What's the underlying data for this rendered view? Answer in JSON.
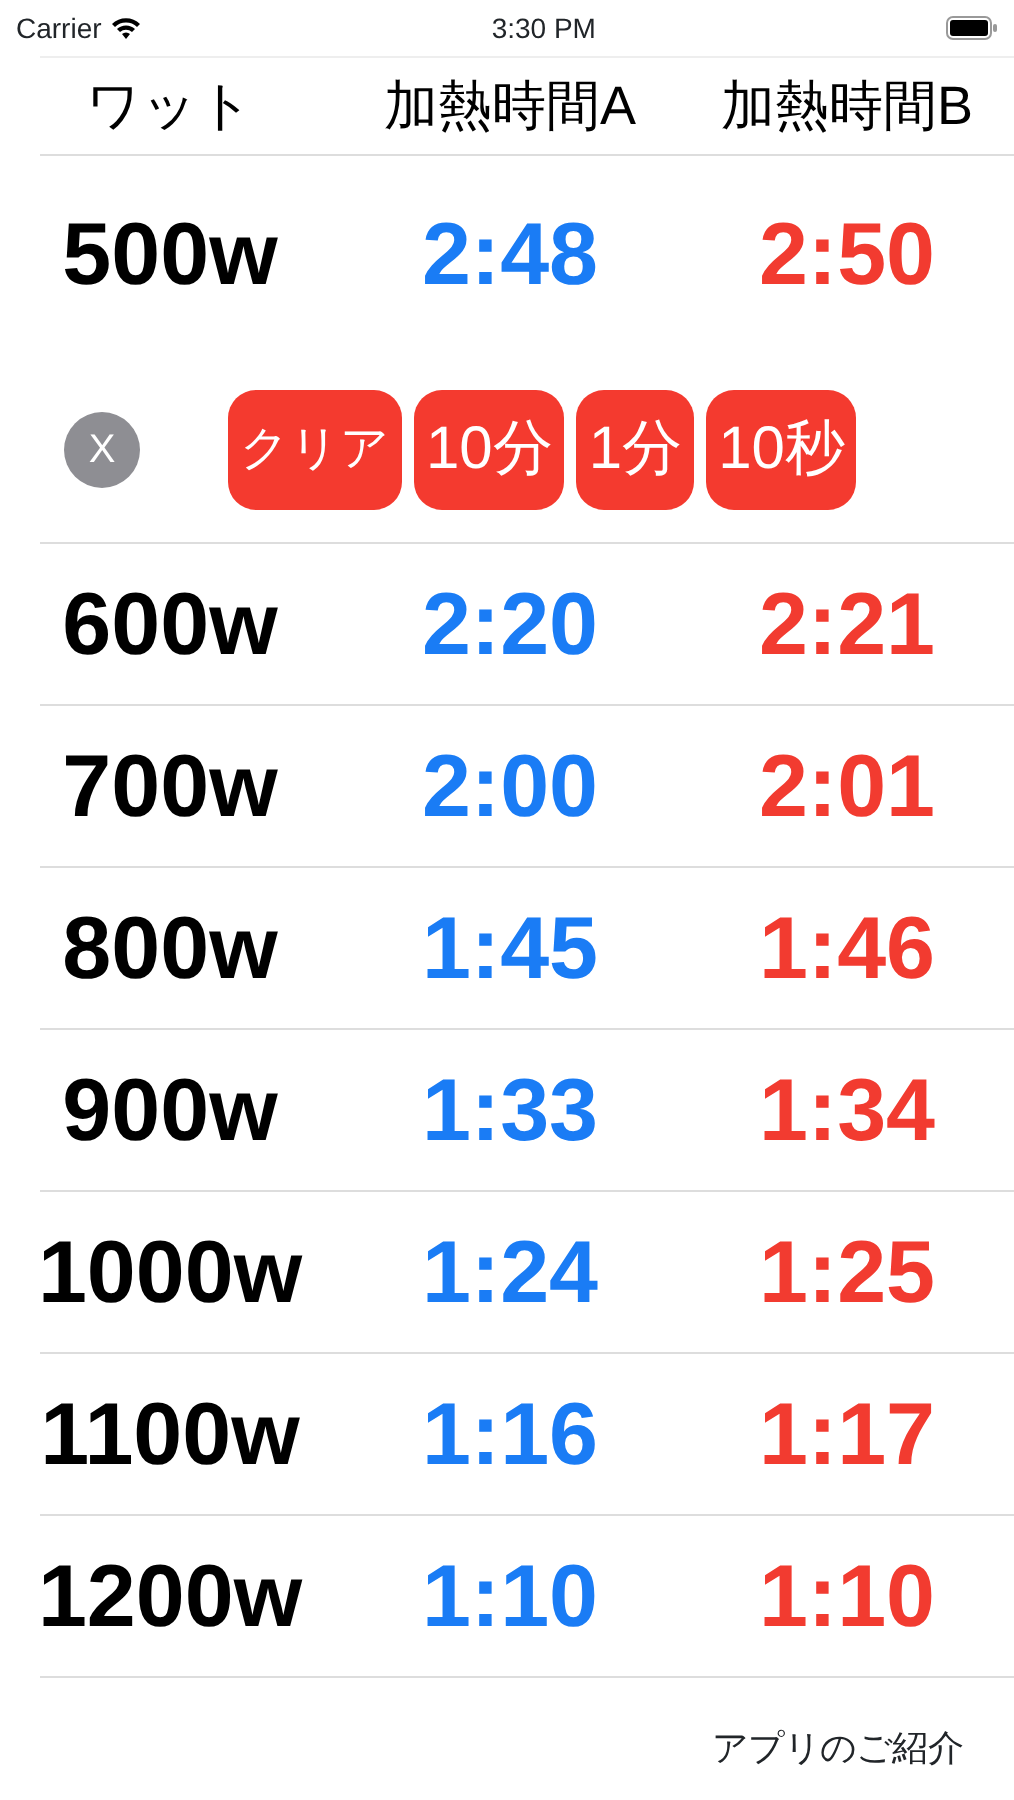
{
  "status_bar": {
    "carrier": "Carrier",
    "time": "3:30 PM"
  },
  "table": {
    "columns": [
      "ワット",
      "加熱時間A",
      "加熱時間B"
    ],
    "rows": [
      {
        "watt": "500w",
        "time_a": "2:48",
        "time_b": "2:50",
        "expanded": true
      },
      {
        "watt": "600w",
        "time_a": "2:20",
        "time_b": "2:21",
        "expanded": false
      },
      {
        "watt": "700w",
        "time_a": "2:00",
        "time_b": "2:01",
        "expanded": false
      },
      {
        "watt": "800w",
        "time_a": "1:45",
        "time_b": "1:46",
        "expanded": false
      },
      {
        "watt": "900w",
        "time_a": "1:33",
        "time_b": "1:34",
        "expanded": false
      },
      {
        "watt": "1000w",
        "time_a": "1:24",
        "time_b": "1:25",
        "expanded": false
      },
      {
        "watt": "1100w",
        "time_a": "1:16",
        "time_b": "1:17",
        "expanded": false
      },
      {
        "watt": "1200w",
        "time_a": "1:10",
        "time_b": "1:10",
        "expanded": false
      }
    ]
  },
  "controls": {
    "close": "X",
    "buttons": [
      "クリア",
      "10分",
      "1分",
      "10秒"
    ]
  },
  "footer_link": "アプリのご紹介"
}
